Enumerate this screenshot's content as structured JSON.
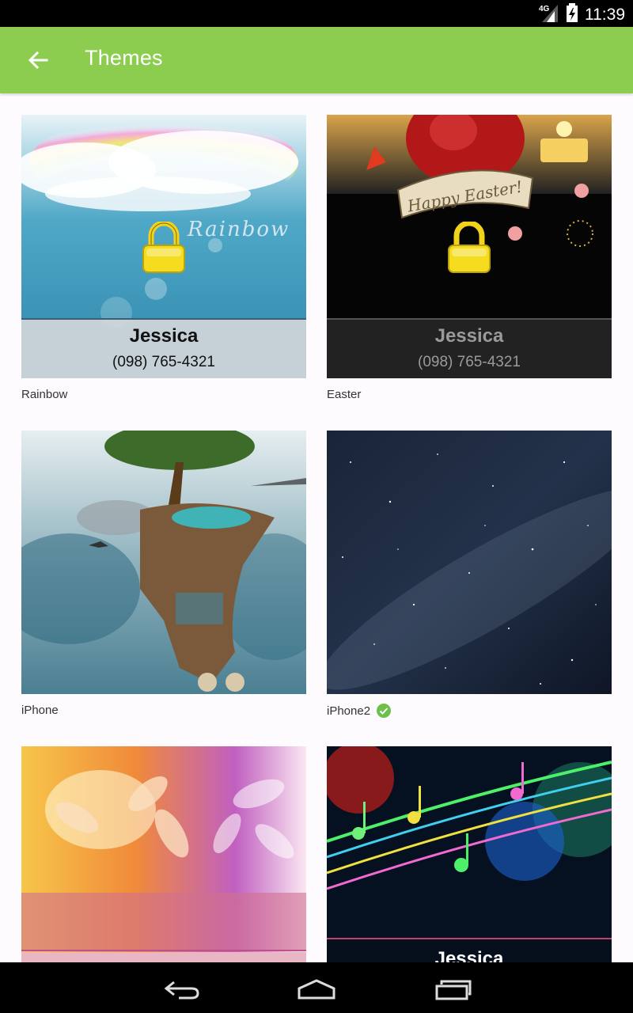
{
  "status_bar": {
    "network": "4G",
    "time": "11:39",
    "icons": [
      "signal-icon",
      "battery-icon"
    ]
  },
  "app_bar": {
    "back_icon": "arrow-left-icon",
    "title": "Themes"
  },
  "themes": [
    {
      "label": "Rainbow",
      "locked": true,
      "selected": false,
      "overlay_text": "Rainbow",
      "contact_name": "Jessica",
      "contact_phone": "(098) 765-4321"
    },
    {
      "label": "Easter",
      "locked": true,
      "selected": false,
      "overlay_text": "Happy Easter!",
      "contact_name": "Jessica",
      "contact_phone": "(098) 765-4321"
    },
    {
      "label": "iPhone",
      "locked": false,
      "selected": false
    },
    {
      "label": "iPhone2",
      "locked": false,
      "selected": true,
      "selected_icon": "check-circle-icon"
    },
    {
      "label": "",
      "locked": false,
      "selected": false
    },
    {
      "label": "",
      "locked": false,
      "selected": false,
      "contact_name": "Jessica"
    }
  ],
  "nav_bar": {
    "back": "nav-back-icon",
    "home": "nav-home-icon",
    "recents": "nav-recents-icon"
  },
  "colors": {
    "app_bar": "#8ccd50",
    "selected_check": "#6cc04a",
    "lock": "#f2d21a"
  }
}
